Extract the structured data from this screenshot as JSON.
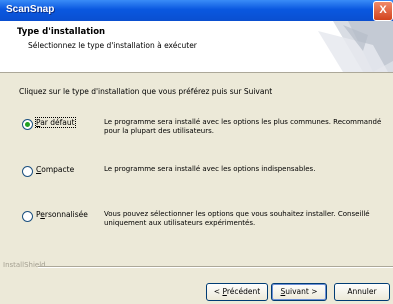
{
  "window": {
    "title": "ScanSnap",
    "close_label": "X"
  },
  "header": {
    "title": "Type d'installation",
    "subtitle": "Sélectionnez le type d'installation à exécuter"
  },
  "intro": "Cliquez sur le type d'installation que vous préférez puis sur Suivant",
  "options": [
    {
      "label_pre": "",
      "label_u": "P",
      "label_post": "ar défaut",
      "checked": true,
      "desc": "Le programme sera installé avec les options les plus communes. Recommandé pour la plupart des utilisateurs."
    },
    {
      "label_pre": "",
      "label_u": "C",
      "label_post": "ompacte",
      "checked": false,
      "desc": "Le programme sera installé avec les options indispensables."
    },
    {
      "label_pre": "P",
      "label_u": "e",
      "label_post": "rsonnalisée",
      "checked": false,
      "desc": "Vous pouvez sélectionner les options que vous souhaitez installer. Conseillé uniquement aux utilisateurs expérimentés."
    }
  ],
  "footer": {
    "brand": "InstallShield"
  },
  "buttons": {
    "back": {
      "pre": "< ",
      "u": "P",
      "post": "récédent"
    },
    "next": {
      "pre": "",
      "u": "S",
      "post": "uivant >"
    },
    "cancel": "Annuler"
  }
}
